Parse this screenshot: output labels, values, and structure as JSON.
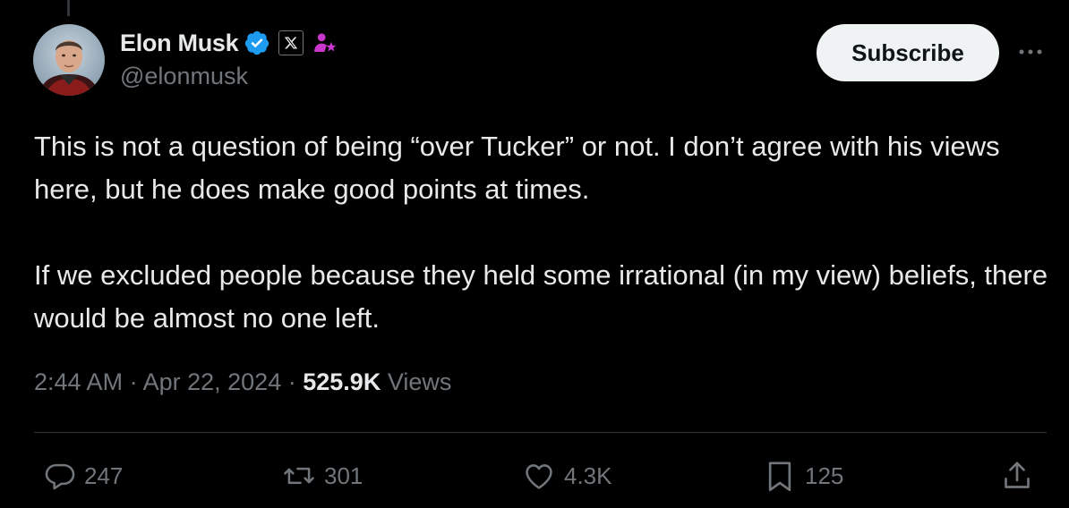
{
  "author": {
    "display_name": "Elon Musk",
    "handle": "@elonmusk",
    "verified": true,
    "verified_color": "#1d9bf0",
    "affiliation_icon": "x-logo-icon",
    "extra_badge_icon": "gift-person-icon",
    "extra_badge_color": "#c936cc"
  },
  "header": {
    "subscribe_label": "Subscribe",
    "more_icon": "more-horizontal-icon"
  },
  "tweet": {
    "paragraphs": [
      "This is not a question of being “over Tucker” or not. I don’t agree with his views here, but he does make good points at times.",
      "If we excluded people because they held some irrational (in my view) beliefs, there would be almost no one left."
    ],
    "time": "2:44 AM",
    "separator": "·",
    "date": "Apr 22, 2024",
    "views_count": "525.9K",
    "views_label": "Views"
  },
  "actions": {
    "replies": {
      "icon": "reply-icon",
      "count": "247"
    },
    "reposts": {
      "icon": "repost-icon",
      "count": "301"
    },
    "likes": {
      "icon": "like-icon",
      "count": "4.3K"
    },
    "bookmarks": {
      "icon": "bookmark-icon",
      "count": "125"
    },
    "share": {
      "icon": "share-icon"
    }
  },
  "colors": {
    "background": "#000000",
    "text_primary": "#e7e9ea",
    "text_secondary": "#71767b",
    "divider": "#2f3336"
  }
}
